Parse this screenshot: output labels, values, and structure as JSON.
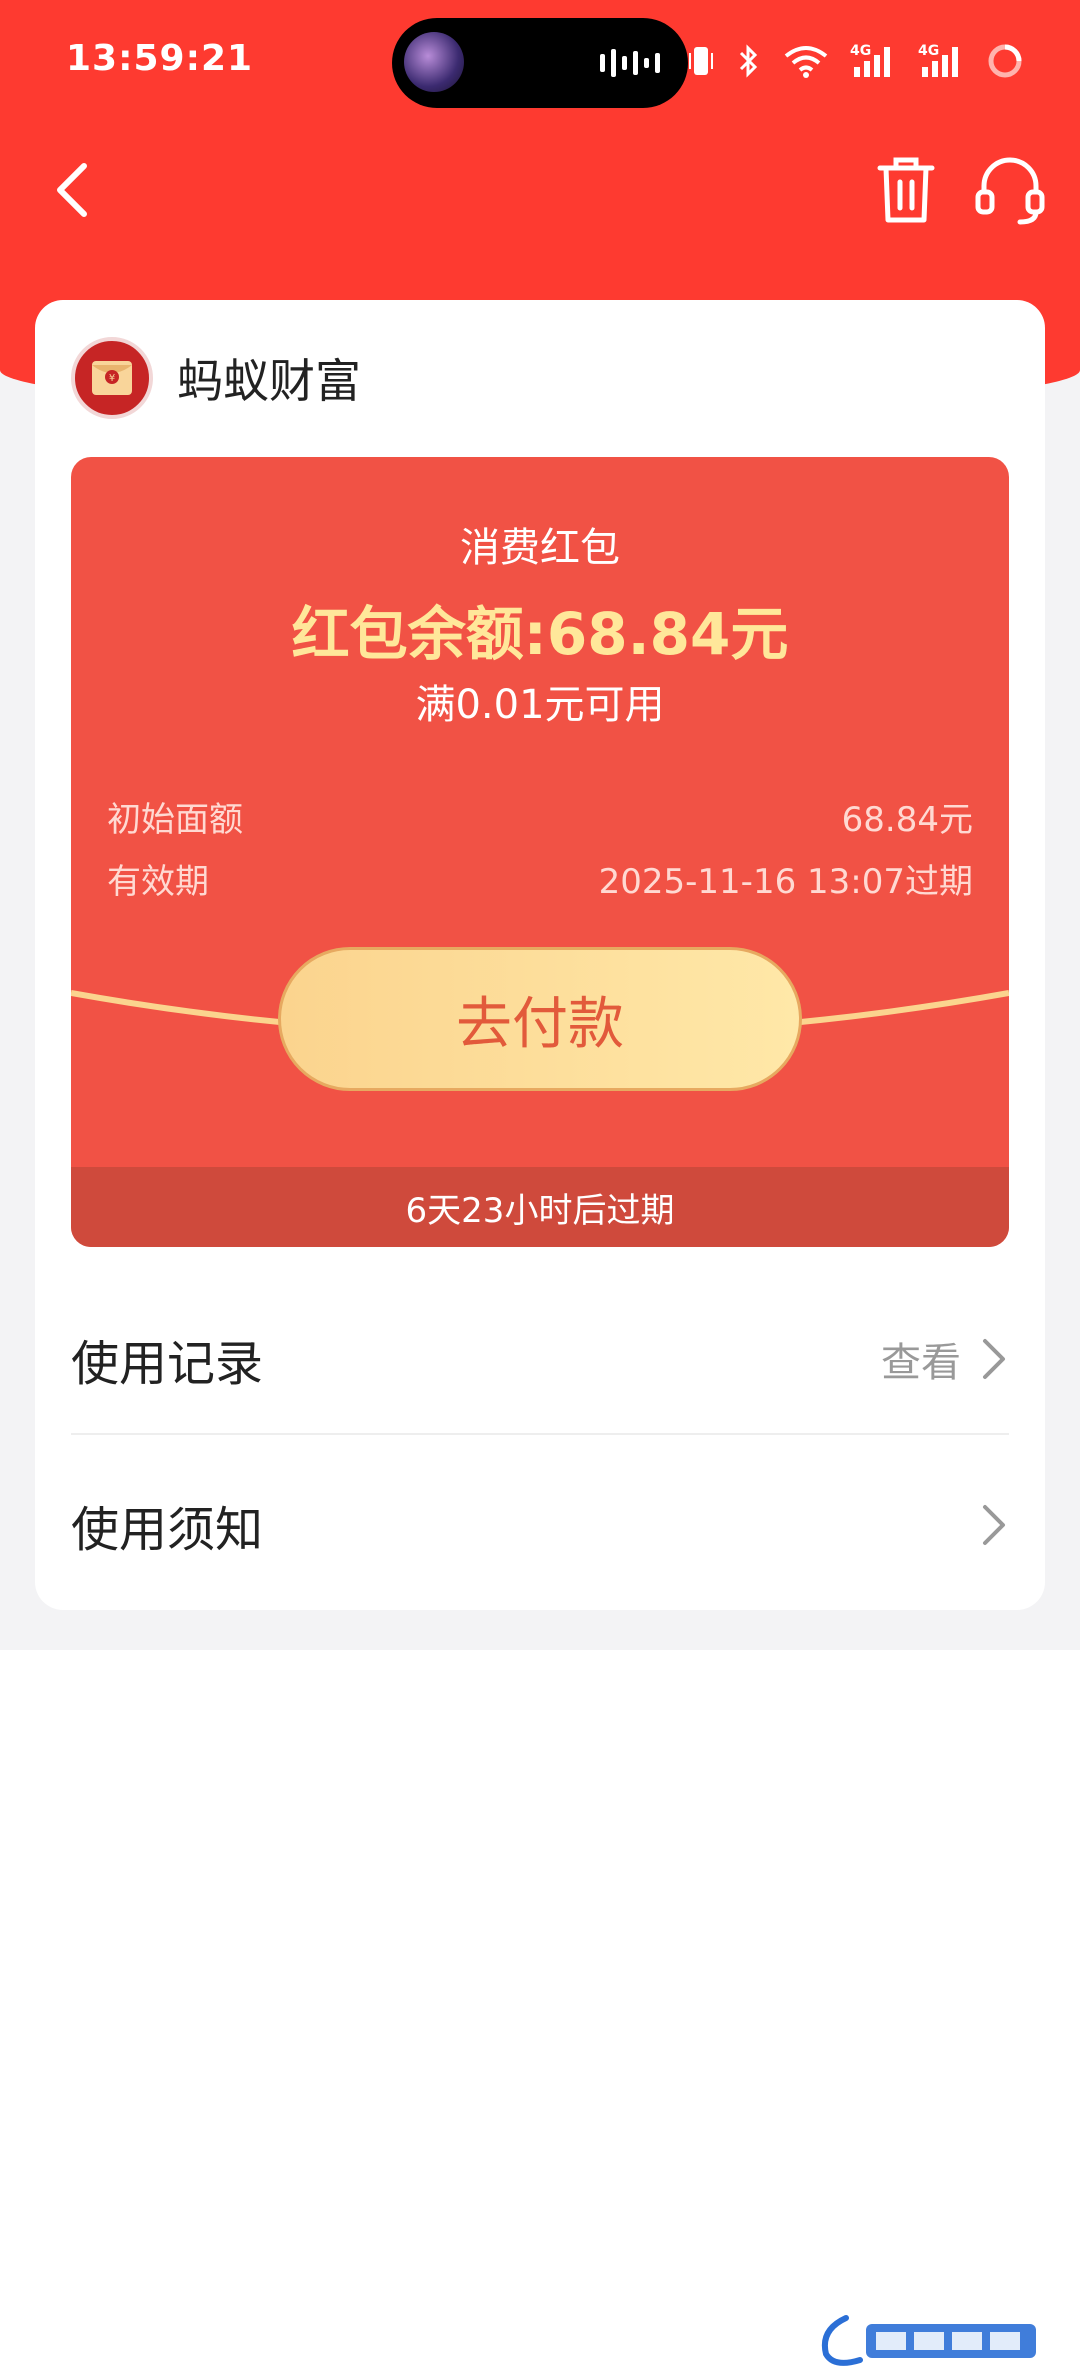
{
  "status_bar": {
    "time": "13:59:21",
    "icons": [
      "vibrate-icon",
      "bluetooth-icon",
      "wifi-icon",
      "signal-4g-icon",
      "signal-4g-icon",
      "battery-icon"
    ],
    "network_label_1": "4G",
    "network_label_2": "4G"
  },
  "nav": {
    "back_icon": "back-arrow-icon",
    "delete_icon": "trash-icon",
    "service_icon": "headset-icon"
  },
  "card": {
    "brand": {
      "name": "蚂蚁财富",
      "logo_icon": "red-envelope-icon"
    },
    "packet": {
      "type": "消费红包",
      "balance": "红包余额:68.84元",
      "threshold": "满0.01元可用",
      "initial_label": "初始面额",
      "initial_value": "68.84元",
      "validity_label": "有效期",
      "validity_value": "2025-11-16 13:07过期",
      "pay_label": "去付款",
      "expire_note": "6天23小时后过期"
    },
    "usage_record": {
      "title": "使用记录",
      "action": "查看"
    },
    "usage_notice": {
      "title": "使用须知"
    }
  },
  "colors": {
    "header_red": "#fe3a30",
    "packet_red": "#f15245",
    "balance_gold": "#ffe79a",
    "pay_text": "#e25a3b"
  }
}
